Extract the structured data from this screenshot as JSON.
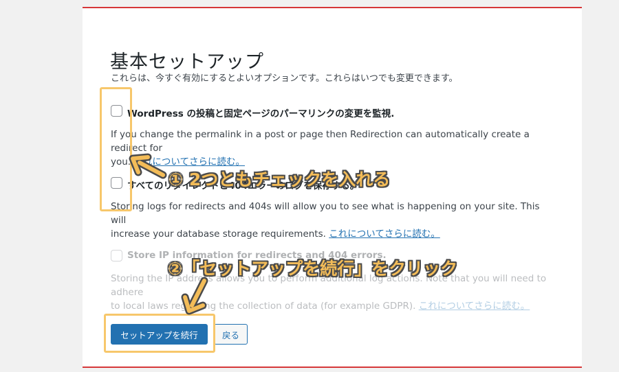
{
  "page": {
    "title": "基本セットアップ",
    "intro": "これらは、今すぐ有効にするとよいオプションです。これらはいつでも変更できます。",
    "read_more": "これについてさらに読む。"
  },
  "options": [
    {
      "label": "WordPress の投稿と固定ページのパーマリンクの変更を監視.",
      "desc_line1": "If you change the permalink in a post or page then Redirection can automatically create a redirect for",
      "desc_line2": "you.",
      "checked": false
    },
    {
      "label": "すべてのリダイレクトと404エラーのログを保存する。",
      "desc_line1": "Storing logs for redirects and 404s will allow you to see what is happening on your site. This will",
      "desc_line2": "increase your database storage requirements.",
      "checked": false
    },
    {
      "label": "Store IP information for redirects and 404 errors.",
      "desc_line1": "Storing the IP address allows you to perform additional log actions. Note that you will need to adhere",
      "desc_line2": "to local laws regarding the collection of data (for example GDPR).",
      "checked": false,
      "disabled": true
    }
  ],
  "buttons": {
    "continue": "セットアップを続行",
    "back": "戻る"
  },
  "annotations": {
    "step1": "① 2つともチェックを入れる",
    "step2": "②「セットアップを続行」をクリック"
  },
  "colors": {
    "accent": "#2271b1",
    "border_top": "#d63638",
    "highlight": "#f7c76b",
    "annotation_text": "#f3bc58"
  }
}
